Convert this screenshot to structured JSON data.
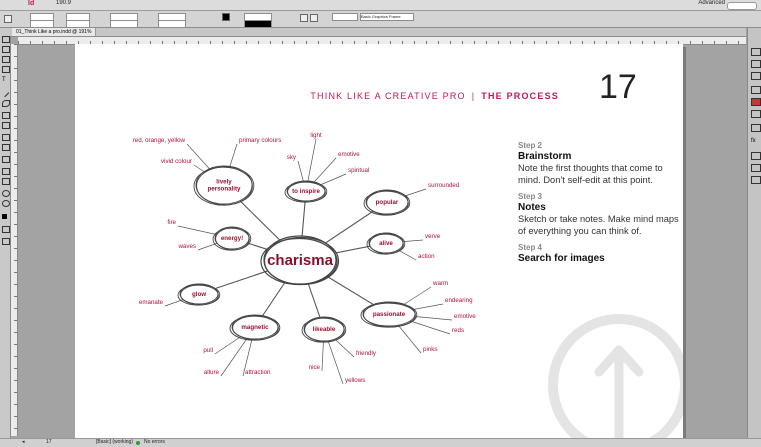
{
  "menubar": {
    "app_id": "Id",
    "zoom": "190.9",
    "workspace": "Advanced"
  },
  "control": {
    "frame_style": "Basic Graphics Frame"
  },
  "document_tab": {
    "label": "01_Think Like a pro.indd @ 191%"
  },
  "status": {
    "page": "17",
    "style": "[Basic] (working)",
    "errors": "No errors"
  },
  "page": {
    "header": {
      "left": "THINK LIKE A CREATIVE PRO",
      "sep": "|",
      "right": "THE PROCESS"
    },
    "number": "17",
    "steps": [
      {
        "label": "Step 2",
        "title": "Brainstorm",
        "text": "Note the first thoughts that come to mind. Don’t self-edit at this point."
      },
      {
        "label": "Step 3",
        "title": "Notes",
        "text": "Sketch or take notes. Make mind maps of everything you can think of."
      },
      {
        "label": "Step 4",
        "title": "Search for images",
        "text": ""
      }
    ]
  },
  "mindmap": {
    "hub": "charisma",
    "nodes": [
      {
        "name": "lively-personality",
        "lines": [
          "lively",
          "personality"
        ],
        "leaves": [
          "red, orange, yellow",
          "primary colours",
          "vivid colour"
        ]
      },
      {
        "name": "to-inspire",
        "lines": [
          "to inspire"
        ],
        "leaves": [
          "light",
          "sky",
          "emotive",
          "spiritual"
        ]
      },
      {
        "name": "popular",
        "lines": [
          "popular"
        ],
        "leaves": [
          "surrounded"
        ]
      },
      {
        "name": "alive",
        "lines": [
          "alive"
        ],
        "leaves": [
          "verve",
          "action"
        ]
      },
      {
        "name": "passionate",
        "lines": [
          "passionate"
        ],
        "leaves": [
          "warm",
          "endearing",
          "emotive",
          "reds",
          "pinks"
        ]
      },
      {
        "name": "likeable",
        "lines": [
          "likeable"
        ],
        "leaves": [
          "friendly",
          "nice",
          "yellows"
        ]
      },
      {
        "name": "magnetic",
        "lines": [
          "magnetic"
        ],
        "leaves": [
          "pull",
          "allure",
          "attraction"
        ]
      },
      {
        "name": "glow",
        "lines": [
          "glow"
        ],
        "leaves": [
          "emanate"
        ]
      },
      {
        "name": "energy",
        "lines": [
          "energy!"
        ],
        "leaves": [
          "fire",
          "waves"
        ]
      }
    ]
  },
  "colors": {
    "accent": "#c2185b",
    "ink": "#333333",
    "sketch": "#555555"
  }
}
